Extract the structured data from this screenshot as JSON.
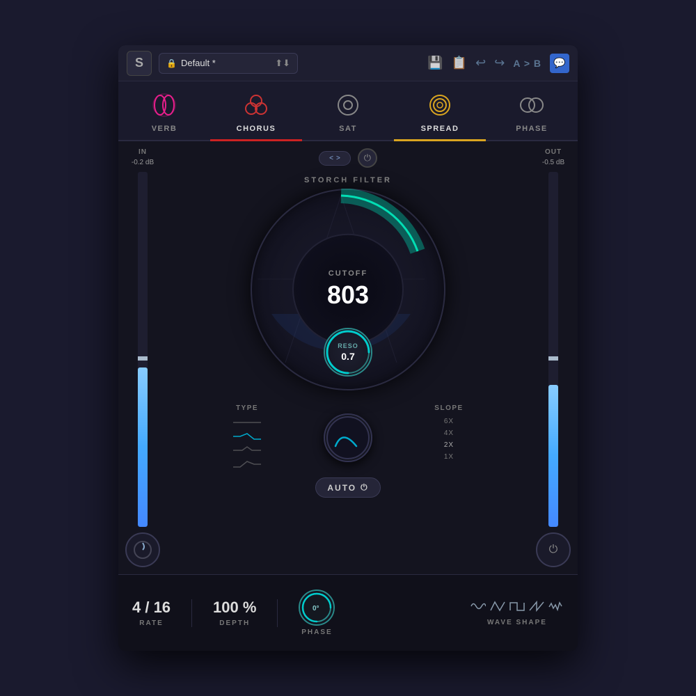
{
  "topbar": {
    "logo": "S",
    "preset_name": "Default *",
    "lock_icon": "🔒",
    "save_label": "💾",
    "copy_label": "📋",
    "undo_label": "↩",
    "redo_label": "↪",
    "ab_label": "A > B",
    "chat_label": "💬"
  },
  "tabs": [
    {
      "id": "verb",
      "label": "VERB",
      "active": false
    },
    {
      "id": "chorus",
      "label": "CHORUS",
      "active": true
    },
    {
      "id": "sat",
      "label": "SAT",
      "active": false
    },
    {
      "id": "spread",
      "label": "SPREAD",
      "active": false
    },
    {
      "id": "phase",
      "label": "PHASE",
      "active": false
    }
  ],
  "filter": {
    "title": "STORCH FILTER",
    "cutoff_label": "CUTOFF",
    "cutoff_value": "803",
    "reso_label": "RESO",
    "reso_value": "0.7"
  },
  "levels": {
    "in_label": "IN",
    "in_db": "-0.2 dB",
    "out_label": "OUT",
    "out_db": "-0.5 dB"
  },
  "type_section": {
    "label": "TYPE",
    "types": [
      "flat",
      "lowpass",
      "peak",
      "highpass"
    ]
  },
  "slope_section": {
    "label": "SLOPE",
    "slopes": [
      "6X",
      "4X",
      "2X",
      "1X"
    ]
  },
  "bottom": {
    "rate_label": "RATE",
    "rate_value": "4 / 16",
    "depth_label": "DEPTH",
    "depth_value": "100 %",
    "phase_label": "PHASE",
    "phase_value": "0°",
    "wave_shape_label": "WAVE SHAPE",
    "auto_label": "AUTO"
  }
}
